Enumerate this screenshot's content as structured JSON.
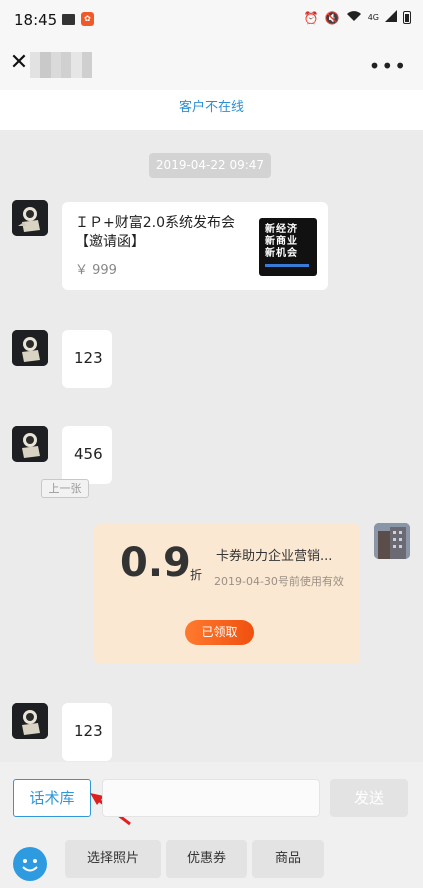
{
  "status_bar": {
    "time": "18:45",
    "network": "4G",
    "icons": [
      "gallery-icon",
      "app-notification-icon",
      "alarm-icon",
      "mute-icon",
      "wifi-icon",
      "signal-icon",
      "battery-icon"
    ]
  },
  "header": {
    "title_redacted": true,
    "close_icon": "close-icon",
    "more_icon": "more-icon"
  },
  "banner": {
    "text": "客户不在线"
  },
  "conversation": {
    "timestamp": "2019-04-22 09:47",
    "product_card": {
      "title": "ＩＰ+财富2.0系统发布会【邀请函】",
      "price": "￥ 999",
      "thumbnail_text": [
        "新",
        "经",
        "济",
        "新",
        "商",
        "业",
        "新",
        "机",
        "会"
      ]
    },
    "messages": [
      {
        "sender": "customer",
        "text": "123"
      },
      {
        "sender": "customer",
        "text": "456"
      }
    ],
    "prev_label": "上一张",
    "coupon": {
      "discount": "0.9",
      "unit": "折",
      "title": "卡券助力企业营销...",
      "validity": "2019-04-30号前使用有效",
      "status_button": "已领取",
      "colors": {
        "background": "#fbe8d3",
        "button": "#f0500f"
      }
    },
    "last_message": {
      "sender": "customer",
      "text": "123"
    }
  },
  "input_bar": {
    "script_library": "话术库",
    "input_value": "",
    "send": "发送",
    "tools": [
      "选择照片",
      "优惠券",
      "商品"
    ],
    "emoji_icon": "emoji-icon"
  },
  "colors": {
    "accent": "#2f97d8",
    "chat_bg": "#ebebeb"
  }
}
